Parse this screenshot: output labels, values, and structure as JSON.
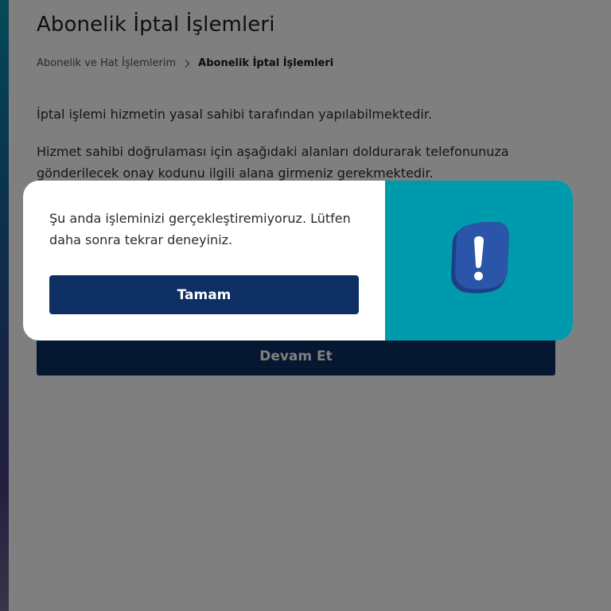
{
  "page": {
    "title": "Abonelik İptal İşlemleri",
    "breadcrumb": {
      "parent": "Abonelik ve Hat İşlemlerim",
      "current": "Abonelik İptal İşlemleri"
    },
    "paragraph_1": "İptal işlemi hizmetin yasal sahibi tarafından yapılabilmektedir.",
    "paragraph_2": "Hizmet sahibi doğrulaması için aşağıdaki alanları doldurarak telefonunuza gönderilecek onay kodunu ilgili alana girmeniz gerekmektedir.",
    "continue_label": "Devam Et"
  },
  "modal": {
    "message": "Şu anda işleminizi gerçekleştiremiyoruz. Lütfen daha sonra tekrar deneyiniz.",
    "ok_label": "Tamam",
    "icon": "exclamation-alert-icon"
  },
  "colors": {
    "primary_navy": "#0d2f63",
    "modal_accent_teal": "#009aad",
    "icon_blue": "#2b55a8"
  }
}
